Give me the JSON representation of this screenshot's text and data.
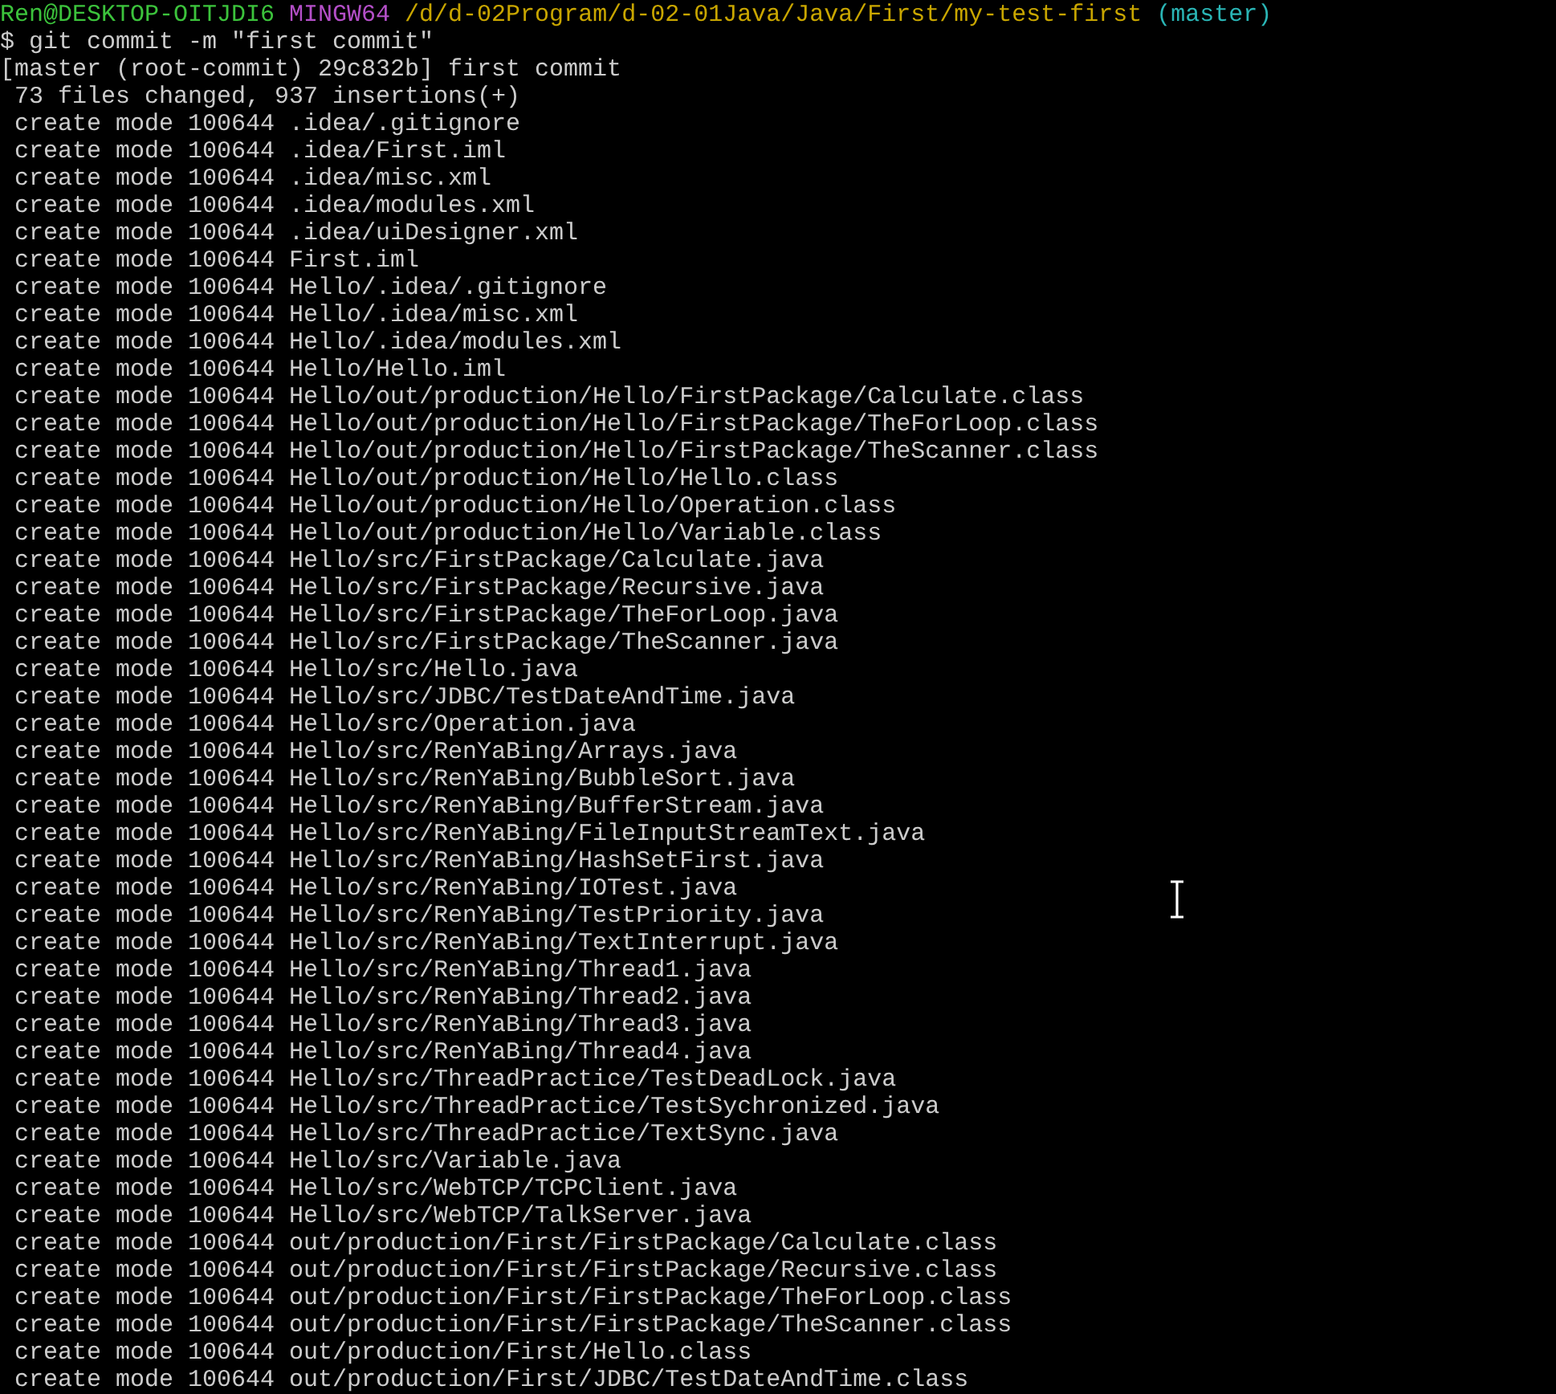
{
  "prompt": {
    "user_host": "Ren@DESKTOP-OITJDI6",
    "shell": "MINGW64",
    "path": "/d/d-02Program/d-02-01Java/Java/First/my-test-first",
    "branch": "(master)"
  },
  "command": "$ git commit -m \"first commit\"",
  "output": [
    {
      "kind": "header",
      "text": "[master (root-commit) 29c832b] first commit"
    },
    {
      "kind": "indented",
      "text": "73 files changed, 937 insertions(+)"
    },
    {
      "kind": "indented",
      "text": "create mode 100644 .idea/.gitignore"
    },
    {
      "kind": "indented",
      "text": "create mode 100644 .idea/First.iml"
    },
    {
      "kind": "indented",
      "text": "create mode 100644 .idea/misc.xml"
    },
    {
      "kind": "indented",
      "text": "create mode 100644 .idea/modules.xml"
    },
    {
      "kind": "indented",
      "text": "create mode 100644 .idea/uiDesigner.xml"
    },
    {
      "kind": "indented",
      "text": "create mode 100644 First.iml"
    },
    {
      "kind": "indented",
      "text": "create mode 100644 Hello/.idea/.gitignore"
    },
    {
      "kind": "indented",
      "text": "create mode 100644 Hello/.idea/misc.xml"
    },
    {
      "kind": "indented",
      "text": "create mode 100644 Hello/.idea/modules.xml"
    },
    {
      "kind": "indented",
      "text": "create mode 100644 Hello/Hello.iml"
    },
    {
      "kind": "indented",
      "text": "create mode 100644 Hello/out/production/Hello/FirstPackage/Calculate.class"
    },
    {
      "kind": "indented",
      "text": "create mode 100644 Hello/out/production/Hello/FirstPackage/TheForLoop.class"
    },
    {
      "kind": "indented",
      "text": "create mode 100644 Hello/out/production/Hello/FirstPackage/TheScanner.class"
    },
    {
      "kind": "indented",
      "text": "create mode 100644 Hello/out/production/Hello/Hello.class"
    },
    {
      "kind": "indented",
      "text": "create mode 100644 Hello/out/production/Hello/Operation.class"
    },
    {
      "kind": "indented",
      "text": "create mode 100644 Hello/out/production/Hello/Variable.class"
    },
    {
      "kind": "indented",
      "text": "create mode 100644 Hello/src/FirstPackage/Calculate.java"
    },
    {
      "kind": "indented",
      "text": "create mode 100644 Hello/src/FirstPackage/Recursive.java"
    },
    {
      "kind": "indented",
      "text": "create mode 100644 Hello/src/FirstPackage/TheForLoop.java"
    },
    {
      "kind": "indented",
      "text": "create mode 100644 Hello/src/FirstPackage/TheScanner.java"
    },
    {
      "kind": "indented",
      "text": "create mode 100644 Hello/src/Hello.java"
    },
    {
      "kind": "indented",
      "text": "create mode 100644 Hello/src/JDBC/TestDateAndTime.java"
    },
    {
      "kind": "indented",
      "text": "create mode 100644 Hello/src/Operation.java"
    },
    {
      "kind": "indented",
      "text": "create mode 100644 Hello/src/RenYaBing/Arrays.java"
    },
    {
      "kind": "indented",
      "text": "create mode 100644 Hello/src/RenYaBing/BubbleSort.java"
    },
    {
      "kind": "indented",
      "text": "create mode 100644 Hello/src/RenYaBing/BufferStream.java"
    },
    {
      "kind": "indented",
      "text": "create mode 100644 Hello/src/RenYaBing/FileInputStreamText.java"
    },
    {
      "kind": "indented",
      "text": "create mode 100644 Hello/src/RenYaBing/HashSetFirst.java"
    },
    {
      "kind": "indented",
      "text": "create mode 100644 Hello/src/RenYaBing/IOTest.java"
    },
    {
      "kind": "indented",
      "text": "create mode 100644 Hello/src/RenYaBing/TestPriority.java"
    },
    {
      "kind": "indented",
      "text": "create mode 100644 Hello/src/RenYaBing/TextInterrupt.java"
    },
    {
      "kind": "indented",
      "text": "create mode 100644 Hello/src/RenYaBing/Thread1.java"
    },
    {
      "kind": "indented",
      "text": "create mode 100644 Hello/src/RenYaBing/Thread2.java"
    },
    {
      "kind": "indented",
      "text": "create mode 100644 Hello/src/RenYaBing/Thread3.java"
    },
    {
      "kind": "indented",
      "text": "create mode 100644 Hello/src/RenYaBing/Thread4.java"
    },
    {
      "kind": "indented",
      "text": "create mode 100644 Hello/src/ThreadPractice/TestDeadLock.java"
    },
    {
      "kind": "indented",
      "text": "create mode 100644 Hello/src/ThreadPractice/TestSychronized.java"
    },
    {
      "kind": "indented",
      "text": "create mode 100644 Hello/src/ThreadPractice/TextSync.java"
    },
    {
      "kind": "indented",
      "text": "create mode 100644 Hello/src/Variable.java"
    },
    {
      "kind": "indented",
      "text": "create mode 100644 Hello/src/WebTCP/TCPClient.java"
    },
    {
      "kind": "indented",
      "text": "create mode 100644 Hello/src/WebTCP/TalkServer.java"
    },
    {
      "kind": "indented",
      "text": "create mode 100644 out/production/First/FirstPackage/Calculate.class"
    },
    {
      "kind": "indented",
      "text": "create mode 100644 out/production/First/FirstPackage/Recursive.class"
    },
    {
      "kind": "indented",
      "text": "create mode 100644 out/production/First/FirstPackage/TheForLoop.class"
    },
    {
      "kind": "indented",
      "text": "create mode 100644 out/production/First/FirstPackage/TheScanner.class"
    },
    {
      "kind": "indented",
      "text": "create mode 100644 out/production/First/Hello.class"
    },
    {
      "kind": "indented",
      "text": "create mode 100644 out/production/First/JDBC/TestDateAndTime.class"
    }
  ]
}
